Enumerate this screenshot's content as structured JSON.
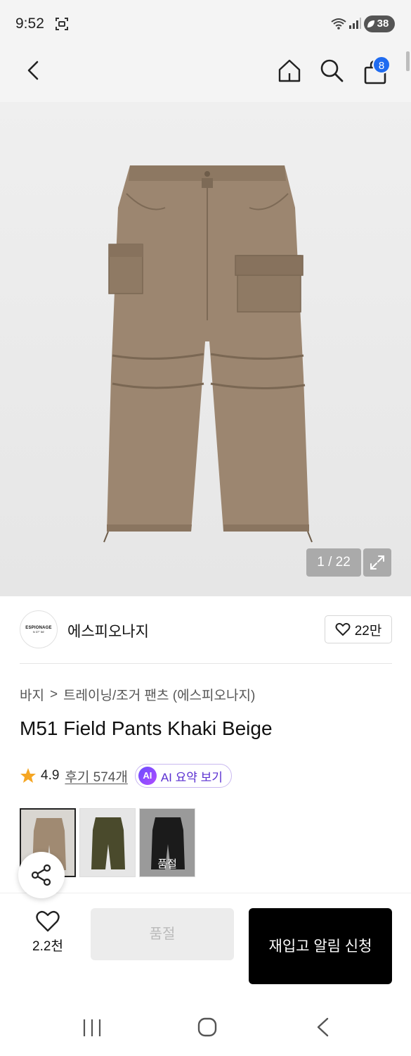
{
  "status_bar": {
    "time": "9:52",
    "battery": "38"
  },
  "header": {
    "cart_count": "8"
  },
  "gallery": {
    "counter": "1 / 22"
  },
  "brand": {
    "logo_text": "ESPIONAGE",
    "logo_sub": "N 37° 56'",
    "name": "에스피오나지",
    "like_count": "22만"
  },
  "breadcrumb": {
    "category": "바지",
    "separator": ">",
    "subcategory": "트레이닝/조거 팬츠 (에스피오나지)"
  },
  "product": {
    "title": "M51 Field Pants Khaki Beige",
    "rating": "4.9",
    "review_label": "후기 574개",
    "ai_badge": "AI",
    "ai_label": "AI 요약 보기"
  },
  "swatches": [
    {
      "color": "#a08a72",
      "label": ""
    },
    {
      "color": "#4a4a2c",
      "label": ""
    },
    {
      "color": "#1b1b1b",
      "label": "품절"
    }
  ],
  "bottom": {
    "wish_count": "2.2천",
    "soldout_label": "품절",
    "restock_label": "재입고 알림 신청"
  },
  "colors": {
    "accent_blue": "#1f6bf0",
    "star": "#f5a623",
    "ai_purple": "#5a2fd1",
    "pants": "#9c8670"
  }
}
